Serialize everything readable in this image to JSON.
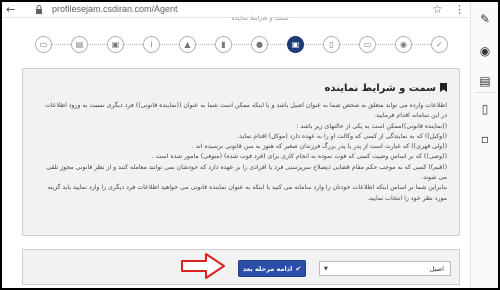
{
  "browser": {
    "url": "profilesejam.csdiran.com/Agent",
    "back_icon": "arrow-left-icon",
    "lock_icon": "lock-icon",
    "star_icon": "star-icon",
    "menu_icon": "more-vertical-icon"
  },
  "steps": {
    "label": "سمت و شرایط نماینده",
    "items": [
      {
        "icon": "wallet-icon",
        "glyph": "▭"
      },
      {
        "icon": "file-icon",
        "glyph": "▤"
      },
      {
        "icon": "id-card-icon",
        "glyph": "▣"
      },
      {
        "icon": "info-icon",
        "glyph": "i"
      },
      {
        "icon": "graduation-cap-icon",
        "glyph": "▲"
      },
      {
        "icon": "bookmark-icon",
        "glyph": "▮"
      },
      {
        "icon": "person-icon",
        "glyph": "●"
      },
      {
        "icon": "id-card-icon",
        "glyph": "▣"
      },
      {
        "icon": "mobile-icon",
        "glyph": "▯"
      },
      {
        "icon": "card-icon",
        "glyph": "▭"
      },
      {
        "icon": "location-icon",
        "glyph": "◉"
      },
      {
        "icon": "check-icon",
        "glyph": "✓"
      }
    ]
  },
  "card": {
    "title": "سمت و شرایط نماینده",
    "lines": [
      "اطلاعات وارده می تواند متعلق به شخص شما به عنوان اصیل باشد و یا اینکه ممکن است شما به عنوان ((نماینده قانونی)) فرد دیگری نسبت به ورود اطلاعات",
      "در این سامانه اقدام فرمایید.",
      "((نماینده قانونی))ممکن است به یکی از حالتهای زیر باشد :",
      "((وکیل)) که به نمایندگی از کسی که وکالت او را به عهده دارد (موکل) اقدام نماید.",
      "((ولی قهری)) که عبارت است از پدر یا پدر بزرگ فرزندان صغیر که هنوز به سن قانونی نرسیده اند .",
      "((وصی)) که بر اساس وصیت کسی که فوت نموده به انجام کاری برای (فرد فوت شده) (متوفی) مامور شده است .",
      "((قیم)) کسی که به موجب حکم مقام قضایی ذیصلاح سرپرستی فرد یا افرادی را بر عهده دارد که خودشان نمی توانند معامله کنند و از نظر قانونی مجوز تلقی",
      "می شوند.",
      "بنابراین شما بر اساس اینکه اطلاعات خودتان را وارد سامانه می کنید یا اینکه به عنوان نماینده قانونی می خواهید اطلاعات فرد دیگری را وارد نمایید باید گزینه",
      "مورد نظر خود را انتخاب نمایید."
    ]
  },
  "form": {
    "select_value": "اصیل",
    "next_label": "ادامه مرحله بعد"
  },
  "sidebar": {
    "icons": [
      "edit-icon",
      "eye-icon",
      "document-icon",
      "mobile-icon",
      "trash-icon"
    ]
  },
  "colors": {
    "primary": "#2b4ea8",
    "step_active": "#1f3c78",
    "annotation": "#e02020"
  }
}
